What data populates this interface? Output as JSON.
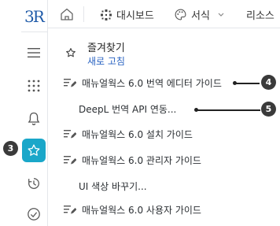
{
  "rail": {
    "logo": "3R",
    "callout_badge": "3"
  },
  "topbar": {
    "dashboard_label": "대시보드",
    "style_label": "서식",
    "resource_label": "리소스"
  },
  "favorites": {
    "title": "즐겨찾기",
    "refresh_label": "새로 고침",
    "items": [
      {
        "label": "매뉴얼웍스 6.0 번역 에디터 가이드",
        "has_icon": true,
        "badge": "4"
      },
      {
        "label": "DeepL 번역 API 연동...",
        "has_icon": false,
        "badge": "5"
      },
      {
        "label": "매뉴얼웍스 6.0 설치 가이드",
        "has_icon": true
      },
      {
        "label": "매뉴얼웍스 6.0 관리자 가이드",
        "has_icon": true
      },
      {
        "label": "UI 색상 바꾸기...",
        "has_icon": false
      },
      {
        "label": "매뉴얼웍스 6.0 사용자 가이드",
        "has_icon": true
      }
    ]
  },
  "colors": {
    "accent": "#1aa7c9",
    "link": "#2a63c2",
    "badge": "#3a3a3a"
  }
}
